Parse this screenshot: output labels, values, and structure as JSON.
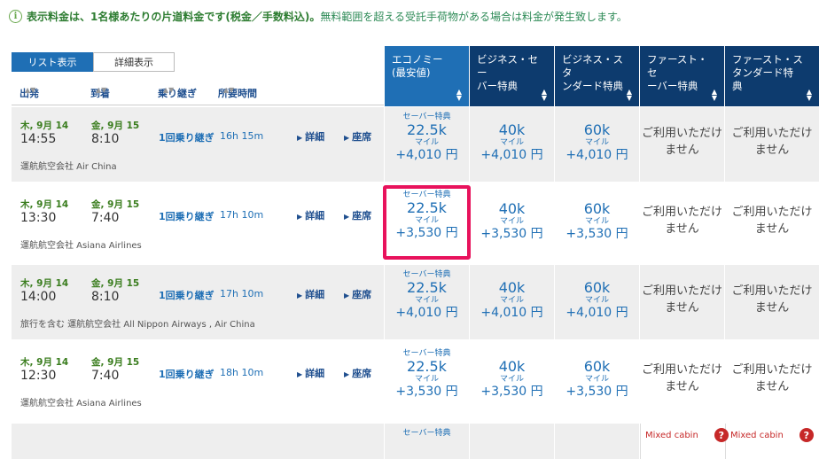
{
  "notice": {
    "strong": "表示料金は、1名様あたりの片道料金です(税金／手数料込)。",
    "rest": "無料範囲を超える受託手荷物がある場合は料金が発生致します。"
  },
  "view_toggle": {
    "list": "リスト表示",
    "detail": "詳細表示"
  },
  "columns": {
    "departure": "出発",
    "arrival": "到着",
    "connections": "乗り継ぎ",
    "duration": "所要時間"
  },
  "cabins": [
    {
      "label": "エコノミー\n(最安値)",
      "color": "#1f6fb5"
    },
    {
      "label": "ビジネス・セー\nバー特典",
      "color": "#0d3b6e"
    },
    {
      "label": "ビジネス・スタ\nンダード特典",
      "color": "#0d3b6e"
    },
    {
      "label": "ファースト・セ\nーバー特典",
      "color": "#0d3b6e"
    },
    {
      "label": "ファースト・ス\nタンダード特\n典",
      "color": "#0d3b6e"
    }
  ],
  "flights": [
    {
      "dep_date": "木, 9月 14",
      "dep_time": "14:55",
      "arr_date": "金, 9月 15",
      "arr_time": "8:10",
      "stops": "1回乗り継ぎ",
      "duration": "16h 15m",
      "detail": "詳細",
      "seat": "座席",
      "airline": "運航航空会社 Air China",
      "economy": {
        "tag": "セーバー特典",
        "miles": "22.5k",
        "unit": "マイル",
        "price": "+4,010 円"
      },
      "biz_saver": {
        "miles": "40k",
        "unit": "マイル",
        "price": "+4,010 円"
      },
      "biz_std": {
        "miles": "60k",
        "unit": "マイル",
        "price": "+4,010 円"
      },
      "first_saver": "ご利用いただけ\nません",
      "first_std": "ご利用いただけ\nません"
    },
    {
      "dep_date": "木, 9月 14",
      "dep_time": "13:30",
      "arr_date": "金, 9月 15",
      "arr_time": "7:40",
      "stops": "1回乗り継ぎ",
      "duration": "17h 10m",
      "detail": "詳細",
      "seat": "座席",
      "airline": "運航航空会社 Asiana Airlines",
      "economy": {
        "tag": "セーバー特典",
        "miles": "22.5k",
        "unit": "マイル",
        "price": "+3,530 円"
      },
      "biz_saver": {
        "miles": "40k",
        "unit": "マイル",
        "price": "+3,530 円"
      },
      "biz_std": {
        "miles": "60k",
        "unit": "マイル",
        "price": "+3,530 円"
      },
      "first_saver": "ご利用いただけ\nません",
      "first_std": "ご利用いただけ\nません"
    },
    {
      "dep_date": "木, 9月 14",
      "dep_time": "14:00",
      "arr_date": "金, 9月 15",
      "arr_time": "8:10",
      "stops": "1回乗り継ぎ",
      "duration": "17h 10m",
      "detail": "詳細",
      "seat": "座席",
      "airline": "旅行を含む 運航航空会社 All Nippon Airways , Air China",
      "economy": {
        "tag": "セーバー特典",
        "miles": "22.5k",
        "unit": "マイル",
        "price": "+4,010 円"
      },
      "biz_saver": {
        "miles": "40k",
        "unit": "マイル",
        "price": "+4,010 円"
      },
      "biz_std": {
        "miles": "60k",
        "unit": "マイル",
        "price": "+4,010 円"
      },
      "first_saver": "ご利用いただけ\nません",
      "first_std": "ご利用いただけ\nません"
    },
    {
      "dep_date": "木, 9月 14",
      "dep_time": "12:30",
      "arr_date": "金, 9月 15",
      "arr_time": "7:40",
      "stops": "1回乗り継ぎ",
      "duration": "18h 10m",
      "detail": "詳細",
      "seat": "座席",
      "airline": "運航航空会社 Asiana Airlines",
      "economy": {
        "tag": "セーバー特典",
        "miles": "22.5k",
        "unit": "マイル",
        "price": "+3,530 円"
      },
      "biz_saver": {
        "miles": "40k",
        "unit": "マイル",
        "price": "+3,530 円"
      },
      "biz_std": {
        "miles": "60k",
        "unit": "マイル",
        "price": "+3,530 円"
      },
      "first_saver": "ご利用いただけ\nません",
      "first_std": "ご利用いただけ\nません"
    }
  ],
  "partial_row": {
    "economy_tag": "セーバー特典",
    "mixed_cabin": "Mixed cabin",
    "help": "?"
  },
  "colors": {
    "accent": "#1f6fb5",
    "dark_header": "#0d3b6e",
    "highlight": "#e8125c",
    "success": "#2e7d32"
  }
}
